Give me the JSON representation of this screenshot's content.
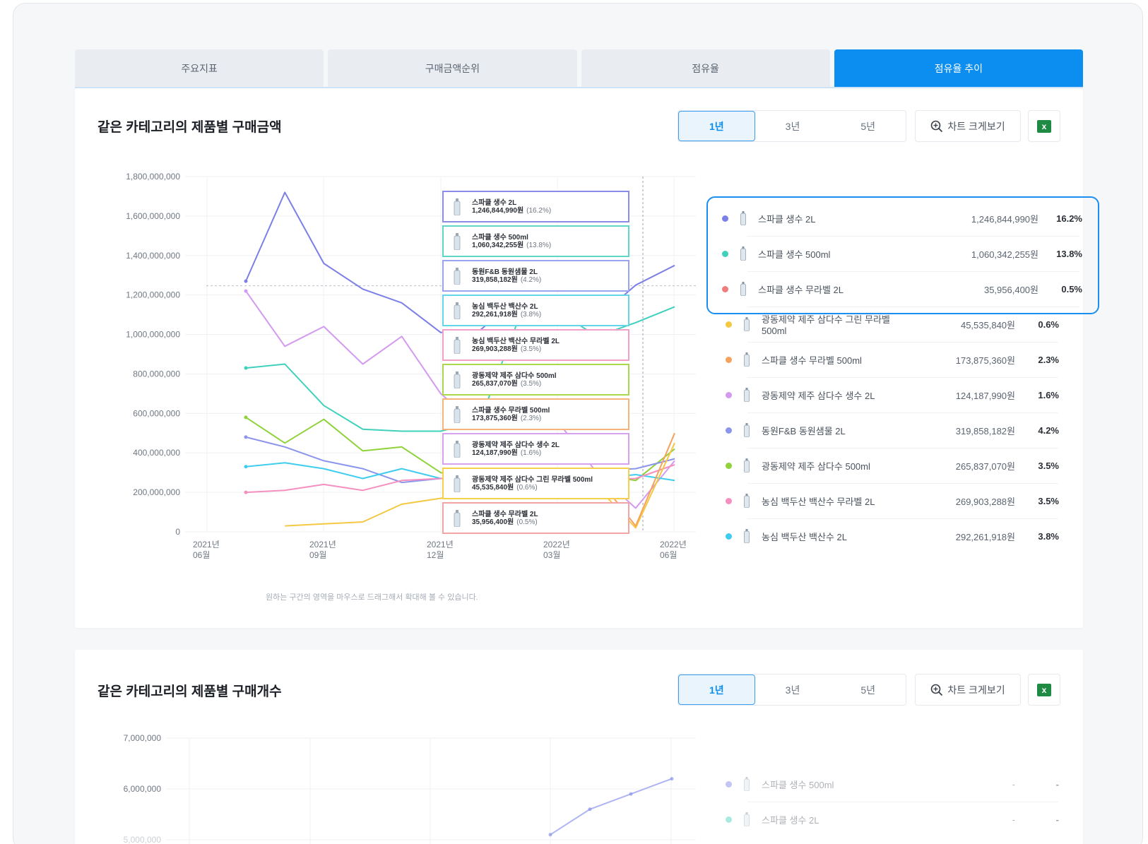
{
  "tabs": [
    {
      "label": "주요지표"
    },
    {
      "label": "구매금액순위"
    },
    {
      "label": "점유율"
    },
    {
      "label": "점유율 추이"
    }
  ],
  "accent_color": "#0b8ef0",
  "section1": {
    "title": "같은 카테고리의 제품별 구매금액",
    "periods": [
      "1년",
      "3년",
      "5년"
    ],
    "zoom_label": "차트 크게보기",
    "hint": "원하는 구간의 영역을 마우스로 드래그해서 확대해 볼 수 있습니다.",
    "tooltip": [
      {
        "name": "스파클 생수 2L",
        "value": "1,246,844,990원",
        "pct": "(16.2%)",
        "color": "#8b8be8"
      },
      {
        "name": "스파클 생수 500ml",
        "value": "1,060,342,255원",
        "pct": "(13.8%)",
        "color": "#5ed7c9"
      },
      {
        "name": "동원F&B 동원샘물 2L",
        "value": "319,858,182원",
        "pct": "(4.2%)",
        "color": "#9aa4ee"
      },
      {
        "name": "농심 백두산 백산수 2L",
        "value": "292,261,918원",
        "pct": "(3.8%)",
        "color": "#63d6ea"
      },
      {
        "name": "농심 백두산 백산수 무라벨 2L",
        "value": "269,903,288원",
        "pct": "(3.5%)",
        "color": "#f39fc7"
      },
      {
        "name": "광동제약 제주 삼다수 500ml",
        "value": "265,837,070원",
        "pct": "(3.5%)",
        "color": "#a9d94a"
      },
      {
        "name": "스파클 생수 무라벨 500ml",
        "value": "173,875,360원",
        "pct": "(2.3%)",
        "color": "#f6b37a"
      },
      {
        "name": "광동제약 제주 삼다수 생수 2L",
        "value": "124,187,990원",
        "pct": "(1.6%)",
        "color": "#d6a2f0"
      },
      {
        "name": "광동제약 제주 삼다수 그린 무라벨 500ml",
        "value": "45,535,840원",
        "pct": "(0.6%)",
        "color": "#f5d04a"
      },
      {
        "name": "스파클 생수 무라벨 2L",
        "value": "35,956,400원",
        "pct": "(0.5%)",
        "color": "#f3a5a5"
      }
    ],
    "legend": [
      {
        "name": "스파클 생수 2L",
        "value": "1,246,844,990원",
        "pct": "16.2%",
        "color": "#7b7fe6"
      },
      {
        "name": "스파클 생수 500ml",
        "value": "1,060,342,255원",
        "pct": "13.8%",
        "color": "#3fd1bb"
      },
      {
        "name": "스파클 생수 무라벨 2L",
        "value": "35,956,400원",
        "pct": "0.5%",
        "color": "#f07c7c"
      },
      {
        "name": "광동제약 제주 삼다수 그린 무라벨 500ml",
        "value": "45,535,840원",
        "pct": "0.6%",
        "color": "#f5c842"
      },
      {
        "name": "스파클 생수 무라벨 500ml",
        "value": "173,875,360원",
        "pct": "2.3%",
        "color": "#f5a25c"
      },
      {
        "name": "광동제약 제주 삼다수 생수 2L",
        "value": "124,187,990원",
        "pct": "1.6%",
        "color": "#d39af0"
      },
      {
        "name": "동원F&B 동원샘물 2L",
        "value": "319,858,182원",
        "pct": "4.2%",
        "color": "#8c95ec"
      },
      {
        "name": "광동제약 제주 삼다수 500ml",
        "value": "265,837,070원",
        "pct": "3.5%",
        "color": "#8fd23a"
      },
      {
        "name": "농심 백두산 백산수 무라벨 2L",
        "value": "269,903,288원",
        "pct": "3.5%",
        "color": "#f58fbf"
      },
      {
        "name": "농심 백두산 백산수 2L",
        "value": "292,261,918원",
        "pct": "3.8%",
        "color": "#3fcdef"
      }
    ]
  },
  "section2": {
    "title": "같은 카테고리의 제품별 구매개수",
    "periods": [
      "1년",
      "3년",
      "5년"
    ],
    "zoom_label": "차트 크게보기",
    "legend": [
      {
        "name": "스파클 생수 500ml",
        "value": "-",
        "pct": "-",
        "color": "#7b7fe6"
      },
      {
        "name": "스파클 생수 2L",
        "value": "-",
        "pct": "-",
        "color": "#3fd1bb"
      }
    ]
  },
  "chart_data": [
    {
      "type": "line",
      "title": "같은 카테고리의 제품별 구매금액",
      "ylim": [
        0,
        1800000000
      ],
      "y_ticks": [
        "1,800,000,000",
        "1,600,000,000",
        "1,400,000,000",
        "1,200,000,000",
        "1,000,000,000",
        "800,000,000",
        "600,000,000",
        "400,000,000",
        "200,000,000",
        "0"
      ],
      "x_ticks": [
        [
          "2021년",
          "06월"
        ],
        [
          "2021년",
          "09월"
        ],
        [
          "2021년",
          "12월"
        ],
        [
          "2022년",
          "03월"
        ],
        [
          "2022년",
          "06월"
        ]
      ],
      "x": [
        "2021-07",
        "2021-08",
        "2021-09",
        "2021-10",
        "2021-11",
        "2021-12",
        "2022-01",
        "2022-02",
        "2022-03",
        "2022-04",
        "2022-05",
        "2022-06"
      ],
      "series": [
        {
          "name": "스파클 생수 2L",
          "color": "#7b7fe6",
          "values": [
            1270000000,
            1720000000,
            1360000000,
            1230000000,
            1160000000,
            1010000000,
            1020000000,
            1190000000,
            1180000000,
            1080000000,
            1250000000,
            1350000000
          ]
        },
        {
          "name": "스파클 생수 500ml",
          "color": "#3fd1bb",
          "values": [
            830000000,
            850000000,
            640000000,
            520000000,
            510000000,
            510000000,
            560000000,
            1080000000,
            1120000000,
            990000000,
            1060000000,
            1140000000
          ]
        },
        {
          "name": "광동제약 제주 삼다수 생수 2L",
          "color": "#d39af0",
          "values": [
            1220000000,
            940000000,
            1040000000,
            850000000,
            990000000,
            700000000,
            530000000,
            560000000,
            560000000,
            300000000,
            120000000,
            360000000
          ]
        },
        {
          "name": "광동제약 제주 삼다수 500ml",
          "color": "#8fd23a",
          "values": [
            580000000,
            450000000,
            570000000,
            410000000,
            430000000,
            300000000,
            280000000,
            260000000,
            270000000,
            290000000,
            260000000,
            420000000
          ]
        },
        {
          "name": "동원F&B 동원샘물 2L",
          "color": "#8c95ec",
          "values": [
            480000000,
            430000000,
            360000000,
            320000000,
            250000000,
            270000000,
            280000000,
            250000000,
            280000000,
            310000000,
            320000000,
            370000000
          ]
        },
        {
          "name": "농심 백두산 백산수 2L",
          "color": "#3fcdef",
          "values": [
            330000000,
            350000000,
            320000000,
            270000000,
            320000000,
            270000000,
            280000000,
            290000000,
            290000000,
            270000000,
            290000000,
            260000000
          ]
        },
        {
          "name": "농심 백두산 백산수 무라벨 2L",
          "color": "#f58fbf",
          "values": [
            200000000,
            210000000,
            240000000,
            210000000,
            260000000,
            270000000,
            270000000,
            280000000,
            270000000,
            260000000,
            270000000,
            340000000
          ]
        },
        {
          "name": "광동제약 제주 삼다수 그린 무라벨 500ml",
          "color": "#f5c842",
          "values": [
            null,
            30000000,
            40000000,
            50000000,
            140000000,
            170000000,
            200000000,
            230000000,
            250000000,
            230000000,
            20000000,
            450000000
          ]
        },
        {
          "name": "스파클 생수 무라벨 500ml",
          "color": "#f5a25c",
          "values": [
            null,
            null,
            null,
            null,
            null,
            null,
            null,
            null,
            null,
            280000000,
            30000000,
            500000000
          ]
        }
      ]
    },
    {
      "type": "line",
      "title": "같은 카테고리의 제품별 구매개수",
      "ylim": [
        5000000,
        7000000
      ],
      "y_ticks": [
        "7,000,000",
        "6,000,000",
        "5,000,000"
      ],
      "series": [
        {
          "name": "스파클 생수 500ml",
          "color": "#8c95ec",
          "values": [
            5100000,
            5600000,
            5900000,
            6200000
          ]
        }
      ]
    }
  ]
}
